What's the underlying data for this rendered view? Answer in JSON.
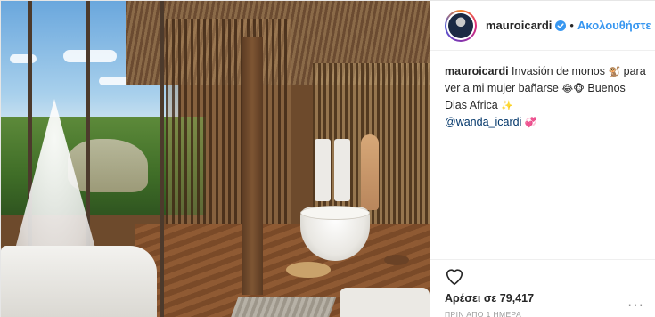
{
  "post": {
    "username": "mauroicardi",
    "dot": "•",
    "follow_label": "Ακολουθήστε",
    "caption": {
      "user": "mauroicardi",
      "text_1": "Invasión de monos",
      "emoji_1": "🐒",
      "text_2": "para ver a mi mujer bañarse",
      "emoji_2": "😂🐵",
      "text_3": "Buenos Dias Africa",
      "emoji_3": "✨",
      "mention": "@wanda_icardi",
      "emoji_4": "💞"
    },
    "likes": "Αρέσει σε 79,417",
    "timestamp": "ΠΡΙΝ ΑΠΟ 1 ΗΜΕΡΑ",
    "more_label": "···"
  },
  "icons": {
    "verified": "verified-badge-icon",
    "heart": "heart-icon",
    "more": "more-options-icon"
  },
  "colors": {
    "link": "#3897f0",
    "verified": "#3897f0",
    "text": "#262626",
    "muted": "#999999"
  }
}
